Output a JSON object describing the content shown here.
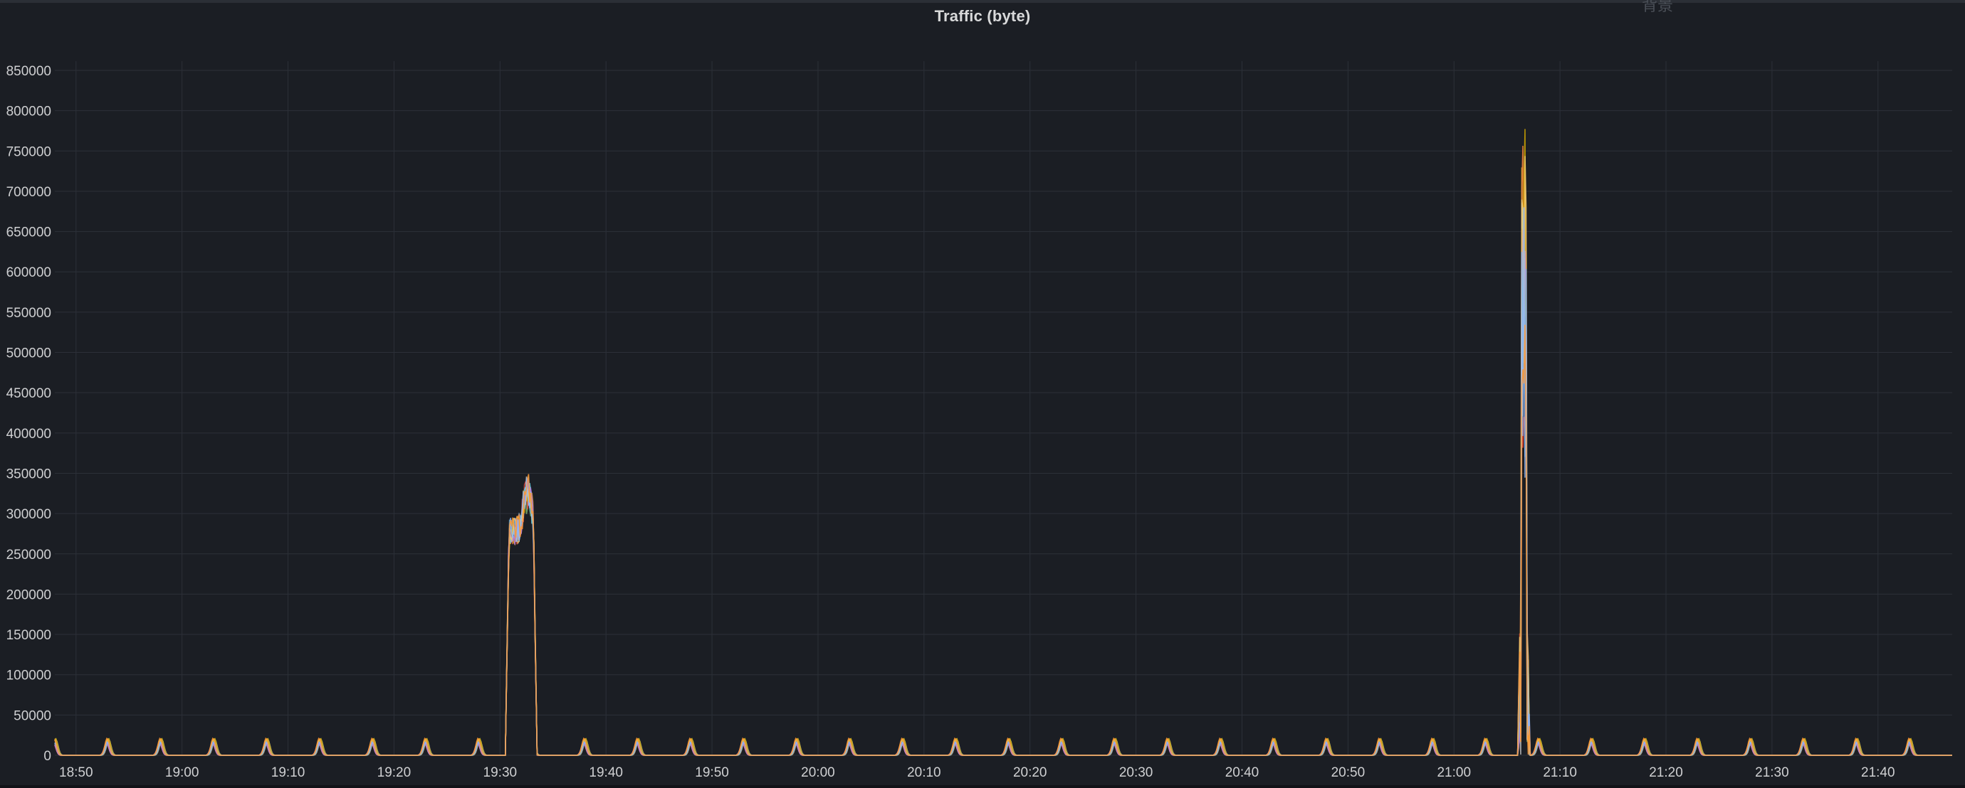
{
  "panel": {
    "title": "Traffic (byte)",
    "corner_text": "背景"
  },
  "colors": {
    "background": "#1b1e24",
    "grid": "#2c3038",
    "tick_text": "#cfd0d2",
    "series": [
      "#e6c02e",
      "#7eb26d",
      "#5aa7d8",
      "#ef843c",
      "#e24d42",
      "#bfbfbf",
      "#cca300",
      "#6ed0e0",
      "#b877d9",
      "#f2c96d",
      "#8ab8ff",
      "#ff9830"
    ]
  },
  "chart_data": {
    "type": "line",
    "title": "Traffic (byte)",
    "xlabel": "",
    "ylabel": "",
    "x_tick_labels": [
      "18:50",
      "19:00",
      "19:10",
      "19:20",
      "19:30",
      "19:40",
      "19:50",
      "20:00",
      "20:10",
      "20:20",
      "20:30",
      "20:40",
      "20:50",
      "21:00",
      "21:10",
      "21:20",
      "21:30",
      "21:40"
    ],
    "y_tick_labels": [
      "0",
      "50000",
      "100000",
      "150000",
      "200000",
      "250000",
      "300000",
      "350000",
      "400000",
      "450000",
      "500000",
      "550000",
      "600000",
      "650000",
      "700000",
      "750000",
      "800000",
      "850000"
    ],
    "ylim": [
      0,
      850000
    ],
    "xlim": [
      "18:48",
      "21:47"
    ],
    "grid": true,
    "legend": "none",
    "series_count": 12,
    "periodic_peak": {
      "interval_minutes": 5,
      "first_peak": "18:48",
      "peak_value": 20000
    },
    "bursts": [
      {
        "start": "19:30:30",
        "end": "19:33:30",
        "peak_time": "19:32:30",
        "peak_value": 340000,
        "plateau_value": 290000
      },
      {
        "start": "21:06:00",
        "end": "21:07:10",
        "peak_time": "21:06:35",
        "peak_value": 780000
      }
    ]
  }
}
